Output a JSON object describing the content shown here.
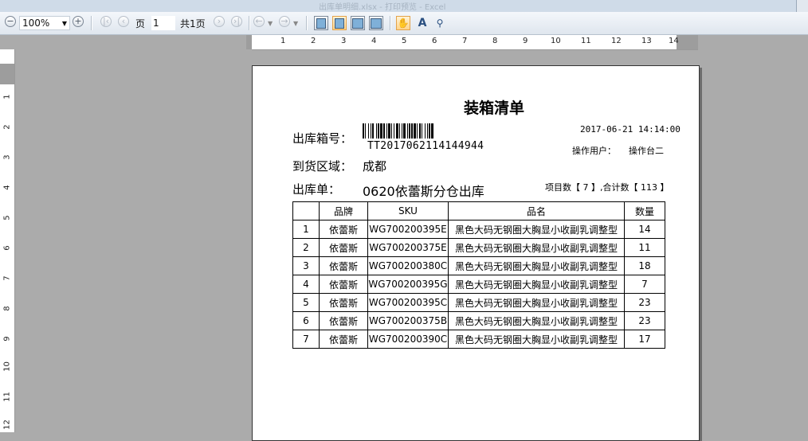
{
  "window": {
    "title": "出库单明细.xlsx - 打印预览 - Excel"
  },
  "toolbar": {
    "zoom": "100%",
    "page_label": "页",
    "page_value": "1",
    "total_pages": "共1页"
  },
  "ruler": {
    "h_ticks": [
      "1",
      "2",
      "3",
      "4",
      "5",
      "6",
      "7",
      "8",
      "9",
      "10",
      "11",
      "12",
      "13",
      "14"
    ],
    "v_ticks": [
      "1",
      "2",
      "3",
      "4",
      "5",
      "6",
      "7",
      "8",
      "9",
      "10",
      "11",
      "12"
    ]
  },
  "document": {
    "title": "装箱清单",
    "box_no_label": "出库箱号：",
    "barcode_text": "TT2017062114144944",
    "datetime": "2017-06-21 14:14:00",
    "operator_label": "操作用户：",
    "operator_value": "操作台二",
    "area_label": "到货区域：",
    "area_value": "成都",
    "order_label": "出库单：",
    "order_value": "0620依蕾斯分仓出库",
    "summary_text": "项目数【 7 】,合计数【  113  】",
    "table": {
      "headers": [
        "",
        "品牌",
        "SKU",
        "品名",
        "数量"
      ],
      "rows": [
        [
          "1",
          "依蕾斯",
          "WG700200395E",
          "黑色大码无钢圈大胸显小收副乳调整型",
          "14"
        ],
        [
          "2",
          "依蕾斯",
          "WG700200375E",
          "黑色大码无钢圈大胸显小收副乳调整型",
          "11"
        ],
        [
          "3",
          "依蕾斯",
          "WG700200380C",
          "黑色大码无钢圈大胸显小收副乳调整型",
          "18"
        ],
        [
          "4",
          "依蕾斯",
          "WG700200395G",
          "黑色大码无钢圈大胸显小收副乳调整型",
          "7"
        ],
        [
          "5",
          "依蕾斯",
          "WG700200395C",
          "黑色大码无钢圈大胸显小收副乳调整型",
          "23"
        ],
        [
          "6",
          "依蕾斯",
          "WG700200375B",
          "黑色大码无钢圈大胸显小收副乳调整型",
          "23"
        ],
        [
          "7",
          "依蕾斯",
          "WG700200390C",
          "黑色大码无钢圈大胸显小收副乳调整型",
          "17"
        ]
      ]
    }
  }
}
